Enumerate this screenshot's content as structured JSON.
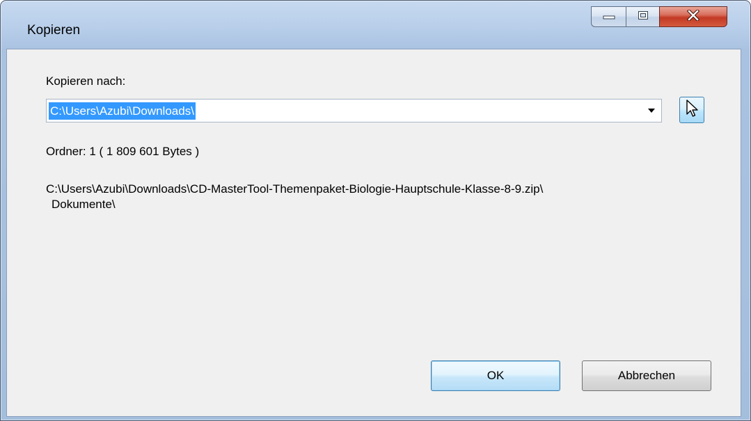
{
  "window": {
    "title": "Kopieren"
  },
  "dialog": {
    "target_label": "Kopieren nach:",
    "target_value": "C:\\Users\\Azubi\\Downloads\\",
    "folder_info": "Ordner: 1    ( 1 809 601 Bytes )",
    "source_path_line1": "C:\\Users\\Azubi\\Downloads\\CD-MasterTool-Themenpaket-Biologie-Hauptschule-Klasse-8-9.zip\\",
    "source_path_line2": "Dokumente\\",
    "ok_label": "OK",
    "cancel_label": "Abbrechen"
  },
  "icons": {
    "minimize": "minimize-icon",
    "maximize": "maximize-icon",
    "close": "close-icon",
    "dropdown": "chevron-down-icon",
    "browse": "cursor-pointer-icon"
  },
  "colors": {
    "selection": "#3399ff",
    "close_button": "#c33a23",
    "dialog_background": "#f0f0f0"
  }
}
